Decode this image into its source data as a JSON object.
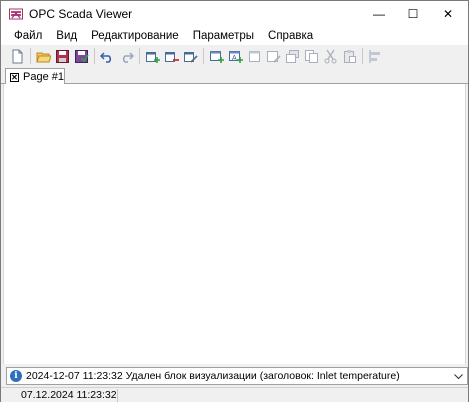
{
  "window": {
    "title": "OPC Scada Viewer",
    "minimize_glyph": "—",
    "maximize_glyph": "☐",
    "close_glyph": "✕"
  },
  "menu": {
    "items": [
      "Файл",
      "Вид",
      "Редактирование",
      "Параметры",
      "Справка"
    ]
  },
  "toolbar": {
    "buttons": [
      "new-document-icon",
      "open-folder-icon",
      "save-icon",
      "save-all-icon",
      "undo-icon",
      "redo-icon",
      "add-page-icon",
      "delete-page-icon",
      "edit-page-icon",
      "add-block-icon",
      "add-text-block-icon",
      "block-icon",
      "edit-block-icon",
      "bring-front-icon",
      "copy-icon",
      "cut-icon",
      "paste-icon",
      "align-icon"
    ]
  },
  "tabs": [
    {
      "label": "Page #1",
      "close_glyph": "✕"
    }
  ],
  "message": {
    "icon": "info-icon",
    "icon_glyph": "i",
    "text": "2024-12-07 11:23:32 Удален блок визуализации (заголовок: Inlet temperature)"
  },
  "status": {
    "datetime": "07.12.2024 11:23:32"
  },
  "colors": {
    "accent": "#2f6fbf",
    "window_bg": "#f0f0f0",
    "canvas_bg": "#ffffff"
  }
}
